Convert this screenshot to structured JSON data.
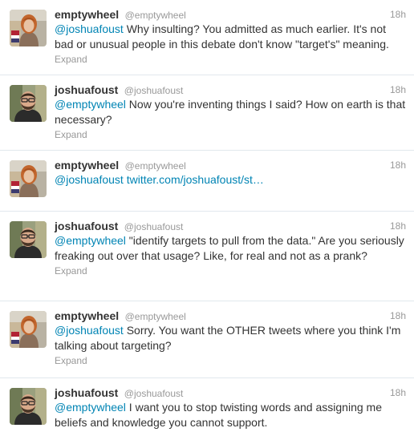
{
  "tweets": [
    {
      "fullname": "emptywheel",
      "username": "@emptywheel",
      "time": "18h",
      "mention": "@joshuafoust",
      "text": " Why insulting? You admitted as much earlier. It's not bad or unusual people in this debate don't know \"target's\" meaning.",
      "expand": "Expand",
      "avatar": "emptywheel-avatar"
    },
    {
      "fullname": "joshuafoust",
      "username": "@joshuafoust",
      "time": "18h",
      "mention": "@emptywheel",
      "text": " Now you're inventing things I said? How on earth is that necessary?",
      "expand": "Expand",
      "avatar": "joshuafoust-avatar"
    },
    {
      "fullname": "emptywheel",
      "username": "@emptywheel",
      "time": "18h",
      "mention": "@joshuafoust",
      "link": " twitter.com/joshuafoust/st…",
      "expand": "",
      "avatar": "emptywheel-avatar"
    },
    {
      "fullname": "joshuafoust",
      "username": "@joshuafoust",
      "time": "18h",
      "mention": "@emptywheel",
      "text": " \"identify targets to pull from the data.\" Are you seriously freaking out over that usage? Like, for real and not as a prank?",
      "expand": "Expand",
      "avatar": "joshuafoust-avatar"
    },
    {
      "fullname": "emptywheel",
      "username": "@emptywheel",
      "time": "18h",
      "mention": "@joshuafoust",
      "text": " Sorry. You want the OTHER tweets where you think I'm talking about targeting?",
      "expand": "Expand",
      "avatar": "emptywheel-avatar"
    },
    {
      "fullname": "joshuafoust",
      "username": "@joshuafoust",
      "time": "18h",
      "mention": "@emptywheel",
      "text": " I want you to stop twisting words and assigning me beliefs and knowledge you cannot support.",
      "expand": "",
      "avatar": "joshuafoust-avatar"
    }
  ],
  "colors": {
    "link": "#0084b4",
    "muted": "#999999",
    "text": "#333333",
    "divider": "#e1e8ed"
  }
}
